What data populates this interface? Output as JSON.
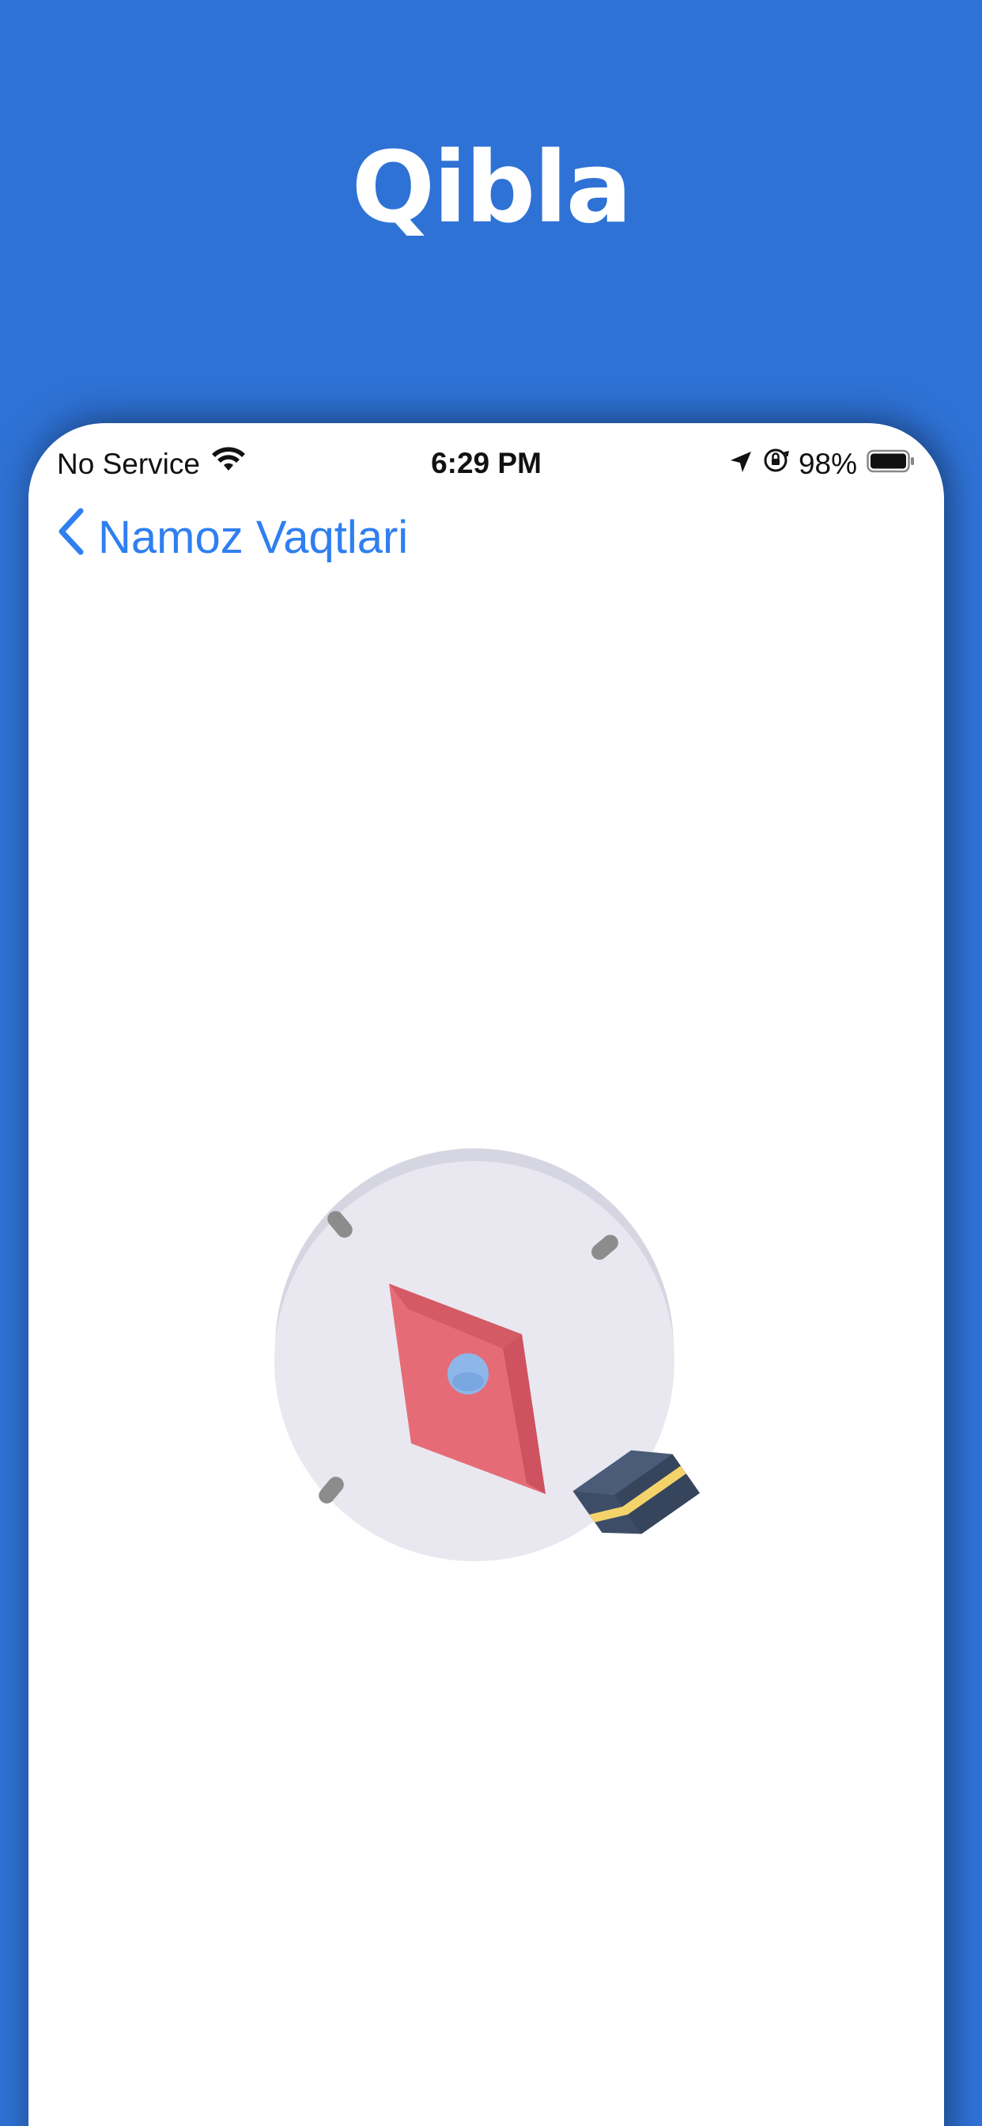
{
  "promo": {
    "title": "Qibla"
  },
  "status_bar": {
    "carrier": "No Service",
    "time": "6:29 PM",
    "battery_percent": "98%",
    "icons": [
      "wifi-icon",
      "location-arrow-icon",
      "orientation-lock-icon",
      "battery-icon"
    ]
  },
  "nav": {
    "back_label": "Namoz Vaqtlari",
    "back_icon": "chevron-left-icon"
  },
  "compass": {
    "icon": "qibla-compass-icon",
    "kaaba_icon": "kaaba-icon"
  },
  "colors": {
    "background": "#2f72d6",
    "accent": "#2f7ff0",
    "needle": "#e56c77",
    "kaaba": "#3d4d67",
    "kaaba_band": "#f4d36a"
  }
}
